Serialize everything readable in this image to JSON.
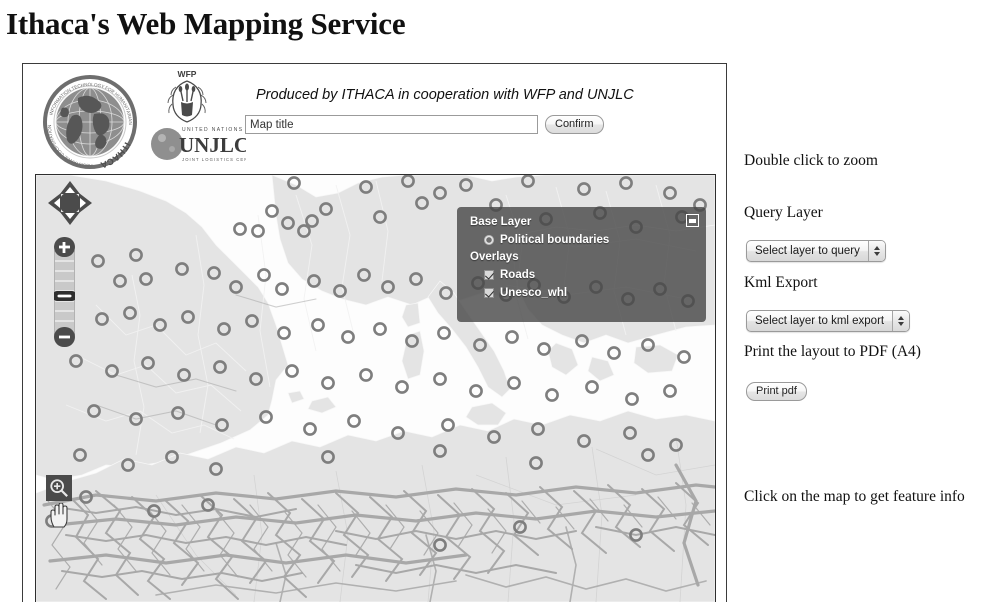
{
  "page": {
    "title": "Ithaca's Web Mapping Service"
  },
  "header": {
    "credit_line": "Produced by ITHACA in cooperation with WFP and UNJLC",
    "map_title_input_value": "Map title",
    "map_title_placeholder": "Map title",
    "confirm_button": "Confirm",
    "logos": [
      {
        "name": "ithaca-logo",
        "alt": "ITHACA"
      },
      {
        "name": "wfp-logo",
        "alt": "WFP"
      },
      {
        "name": "unjlc-logo",
        "alt": "UNJLC"
      }
    ]
  },
  "map": {
    "layer_switcher": {
      "base_layer_heading": "Base Layer",
      "overlays_heading": "Overlays",
      "base_layers": [
        {
          "label": "Political boundaries",
          "selected": true
        }
      ],
      "overlays": [
        {
          "label": "Roads",
          "checked": true
        },
        {
          "label": "Unesco_whl",
          "checked": true
        }
      ],
      "minimize_icon": "minimize-icon",
      "panel_bg": "#464646"
    },
    "controls": {
      "pan_icon": "pan-arrows-icon",
      "zoom_in_label": "+",
      "zoom_out_label": "−",
      "zoom_slider_icon": "zoom-slider",
      "tool_zoom_in_icon": "magnifier-plus-icon",
      "tool_pan_icon": "hand-cursor-icon"
    },
    "colors": {
      "land": "#e4e4e4",
      "ocean": "#fdfdfd",
      "road": "#a8a8a8",
      "marker_ring": "#7e7e7e",
      "border_line": "#ffffff"
    }
  },
  "sidebar": {
    "zoom_hint": "Double click to zoom",
    "query_layer_label": "Query Layer",
    "query_layer_select_value": "Select layer to query",
    "kml_export_label": "Kml Export",
    "kml_export_select_value": "Select layer to kml export",
    "print_label": "Print the layout to PDF (A4)",
    "print_button": "Print pdf",
    "feature_info_hint": "Click on the map to get feature info"
  }
}
